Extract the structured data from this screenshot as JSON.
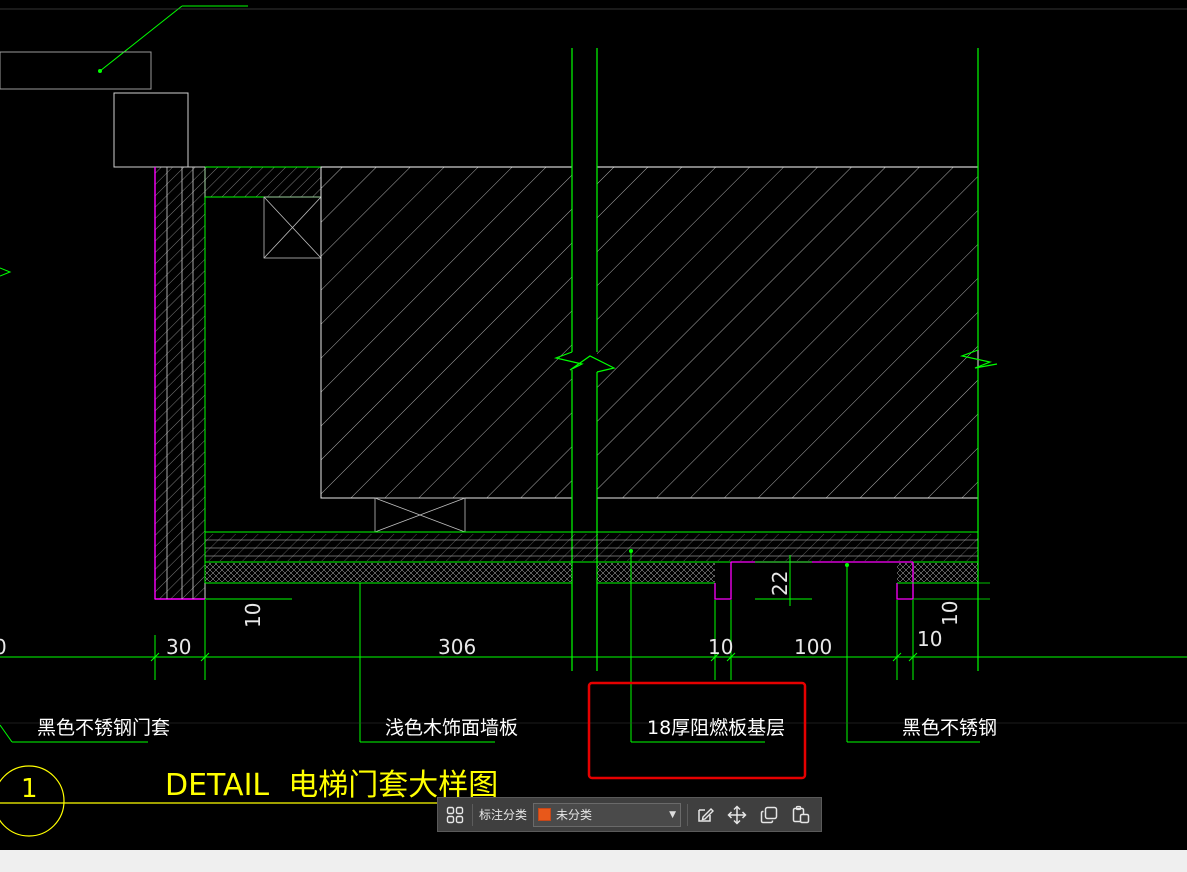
{
  "drawing": {
    "labels": {
      "black_stainless_door_cover": "黑色不锈钢门套",
      "light_wood_wall_panel": "浅色木饰面墙板",
      "fire_retardant_board_base": "18厚阻燃板基层",
      "black_stainless_steel": "黑色不锈钢"
    },
    "dimensions": {
      "d_30": "30",
      "d_306": "306",
      "d_10_a": "10",
      "d_100": "100",
      "d_10_b": "10",
      "d_22": "22",
      "d_10_vertical_left": "10",
      "d_10_vertical_right": "10",
      "d_left_edge": "0"
    },
    "detail": {
      "number": "1",
      "title": "DETAIL  电梯门套大样图"
    }
  },
  "toolbar": {
    "category_label": "标注分类",
    "category_value": "未分类",
    "swatch_color": "#e8581a",
    "icons": [
      "layout-grid-icon",
      "edit-annotation-icon",
      "move-icon",
      "copy-icon",
      "paste-icon"
    ]
  },
  "colors": {
    "line_green": "#00ff00",
    "line_magenta": "#ff00ff",
    "line_white": "#ffffff",
    "text_yellow": "#ffff00",
    "highlight_red": "#e60000"
  }
}
